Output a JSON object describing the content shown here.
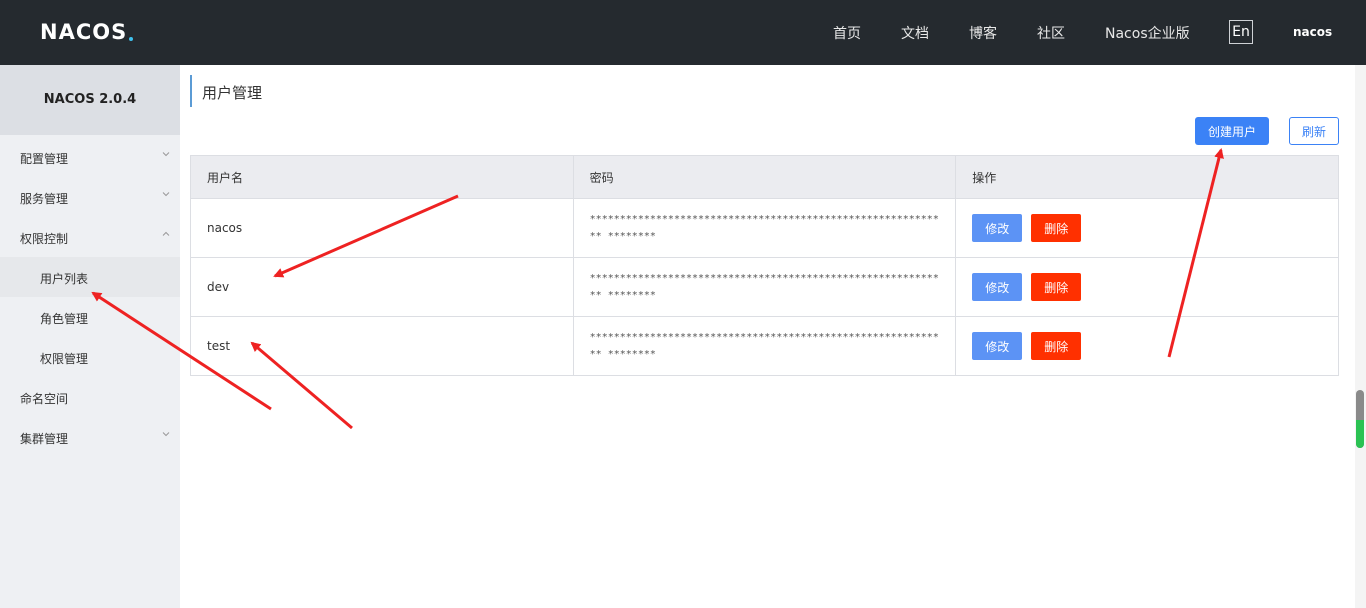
{
  "header": {
    "logo": "NACOS",
    "nav": [
      "首页",
      "文档",
      "博客",
      "社区",
      "Nacos企业版"
    ],
    "lang": "En",
    "user": "nacos"
  },
  "sidebar": {
    "version": "NACOS 2.0.4",
    "items": [
      {
        "label": "配置管理"
      },
      {
        "label": "服务管理"
      },
      {
        "label": "权限控制"
      },
      {
        "label": "用户列表"
      },
      {
        "label": "角色管理"
      },
      {
        "label": "权限管理"
      },
      {
        "label": "命名空间"
      },
      {
        "label": "集群管理"
      }
    ]
  },
  "main": {
    "title": "用户管理",
    "create_label": "创建用户",
    "refresh_label": "刷新",
    "columns": [
      "用户名",
      "密码",
      "操作"
    ],
    "rows": [
      {
        "username": "nacos",
        "password": "************************************************************ ********"
      },
      {
        "username": "dev",
        "password": "************************************************************ ********"
      },
      {
        "username": "test",
        "password": "************************************************************ ********"
      }
    ],
    "edit_label": "修改",
    "delete_label": "删除"
  },
  "colors": {
    "topbar": "#252a2f",
    "primary": "#3b82f6",
    "danger": "#ff3000",
    "annotation": "#ee2222"
  }
}
